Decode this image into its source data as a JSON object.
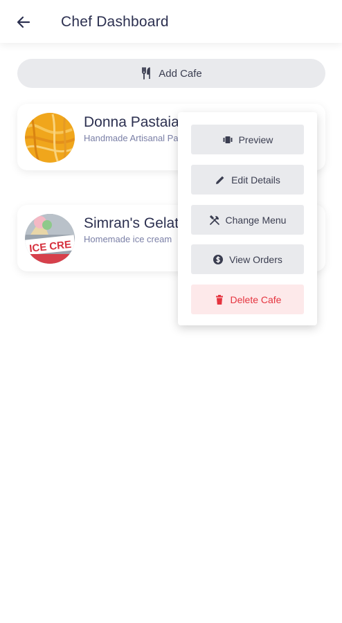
{
  "appbar": {
    "title": "Chef Dashboard"
  },
  "actions": {
    "add_cafe_label": "Add Cafe"
  },
  "cafes": [
    {
      "name": "Donna Pastaia",
      "description": "Handmade Artisanal Pasta",
      "avatar": "pasta-photo"
    },
    {
      "name": "Simran's Gelato",
      "description": "Homemade ice cream",
      "avatar": "ice-cream-sign-photo",
      "avatar_text": "ICE CRE"
    }
  ],
  "context_menu": {
    "items": [
      {
        "label": "Preview",
        "icon": "preview-icon"
      },
      {
        "label": "Edit Details",
        "icon": "pencil-icon"
      },
      {
        "label": "Change Menu",
        "icon": "utensils-cross-icon"
      },
      {
        "label": "View Orders",
        "icon": "dollar-circle-icon"
      },
      {
        "label": "Delete Cafe",
        "icon": "trash-icon"
      }
    ]
  },
  "colors": {
    "title": "#2c3050",
    "button_bg": "#e9eaed",
    "danger": "#e5343f",
    "danger_bg": "#fde9ea",
    "subtitle": "#7a7fa6"
  }
}
